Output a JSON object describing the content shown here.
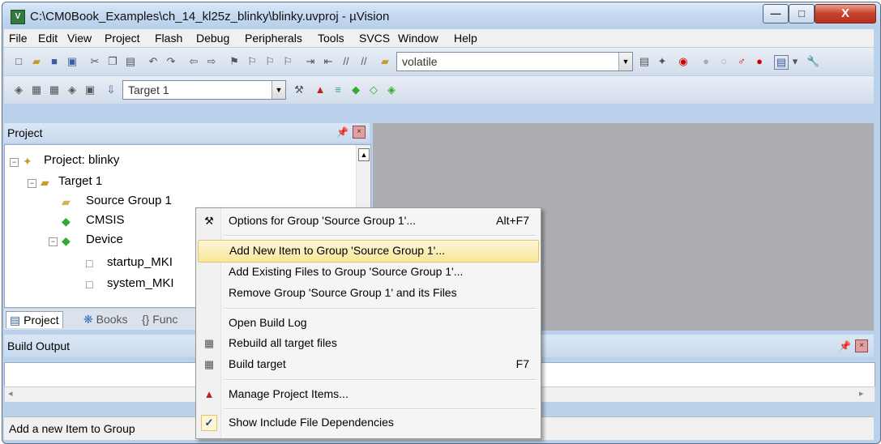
{
  "window": {
    "title": "C:\\CM0Book_Examples\\ch_14_kl25z_blinky\\blinky.uvproj - µVision",
    "app_icon_letter": "V",
    "min_glyph": "—",
    "max_glyph": "□",
    "close_glyph": "X"
  },
  "menu": [
    "File",
    "Edit",
    "View",
    "Project",
    "Flash",
    "Debug",
    "Peripherals",
    "Tools",
    "SVCS",
    "Window",
    "Help"
  ],
  "toolbar": {
    "find_value": "volatile",
    "target_value": "Target 1"
  },
  "project_panel": {
    "title": "Project",
    "tree": {
      "project": "Project: blinky",
      "target": "Target 1",
      "source_group": "Source Group 1",
      "cmsis": "CMSIS",
      "device": "Device",
      "file1": "startup_MKI",
      "file2": "system_MKI"
    },
    "tabs": {
      "project": "Project",
      "books": "Books",
      "functions": "{} Func"
    }
  },
  "build_output": {
    "title": "Build Output"
  },
  "status_bar": {
    "text": "Add a new Item to Group"
  },
  "context_menu": {
    "options": {
      "label": "Options for Group 'Source Group 1'...",
      "shortcut": "Alt+F7"
    },
    "add_new": {
      "label": "Add New  Item to Group 'Source Group 1'..."
    },
    "add_existing": {
      "label": "Add Existing Files to Group 'Source Group 1'..."
    },
    "remove": {
      "label": "Remove Group 'Source Group 1' and its Files"
    },
    "open_log": {
      "label": "Open Build Log"
    },
    "rebuild": {
      "label": "Rebuild all target files"
    },
    "build": {
      "label": "Build target",
      "shortcut": "F7"
    },
    "manage": {
      "label": "Manage Project Items..."
    },
    "show_deps": {
      "label": "Show Include File Dependencies",
      "checked": true
    }
  }
}
